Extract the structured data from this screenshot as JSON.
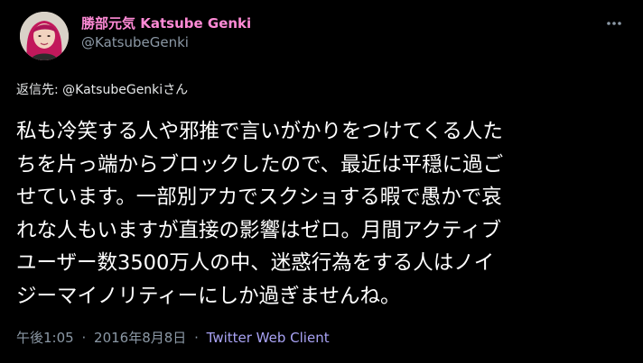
{
  "author": {
    "display_name": "勝部元気 Katsube Genki",
    "handle": "@KatsubeGenki"
  },
  "reply": {
    "label": "返信先: ",
    "mention": "@KatsubeGenki",
    "suffix": "さん"
  },
  "tweet": {
    "lines": [
      "私も冷笑する人や邪推で言いがかりをつけてくる人た",
      "ちを片っ端からブロックしたので、最近は平穏に過ご",
      "せています。一部別アカでスクショする暇で愚かで哀",
      "れな人もいますが直接の影響はゼロ。月間アクティブ",
      "ユーザー数3500万人の中、迷惑行為をする人はノイ",
      "ジーマイノリティーにしか過ぎませんね。"
    ]
  },
  "meta": {
    "time": "午後1:05",
    "separator": "·",
    "date": "2016年8月8日",
    "source": "Twitter Web Client"
  },
  "colors": {
    "background": "#000000",
    "display_name": "#ff8ad6",
    "muted": "#8b98a5",
    "source_link": "#a9a3f5",
    "text": "#ffffff"
  },
  "icons": {
    "more": "more-horizontal-icon"
  }
}
